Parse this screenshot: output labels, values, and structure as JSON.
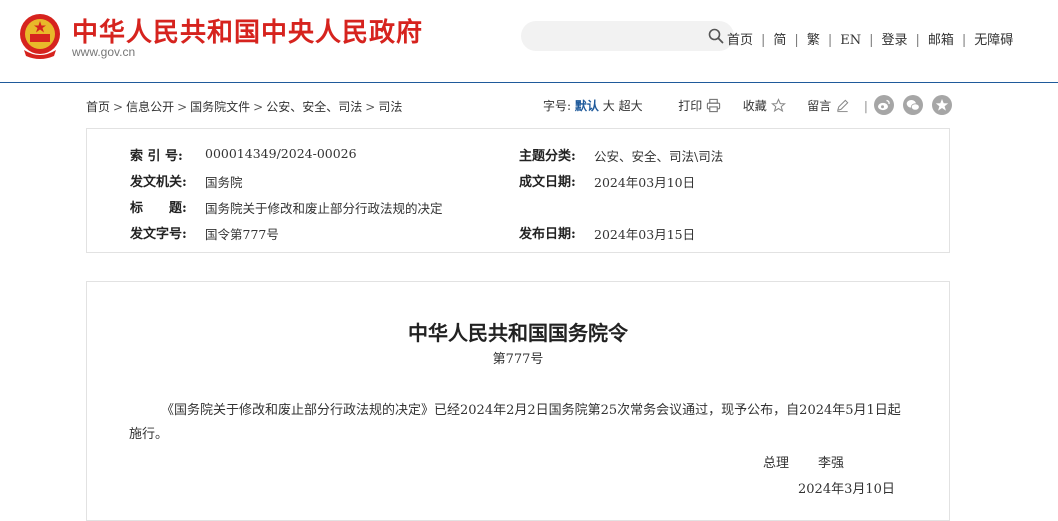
{
  "header": {
    "site_title": "中华人民共和国中央人民政府",
    "site_url": "www.gov.cn",
    "search_placeholder": "",
    "nav": [
      "首页",
      "简",
      "繁",
      "EN",
      "登录",
      "邮箱",
      "无障碍"
    ],
    "brand_color": "#d6231e",
    "line_color": "#1f5a9b"
  },
  "breadcrumb": [
    "首页",
    "信息公开",
    "国务院文件",
    "公安、安全、司法",
    "司法"
  ],
  "tools": {
    "font_label": "字号:",
    "font_default": "默认",
    "font_large": "大",
    "font_xlarge": "超大",
    "print": "打印",
    "favorite": "收藏",
    "comment": "留言",
    "share_icons": [
      "weibo-icon",
      "wechat-icon",
      "star-icon"
    ]
  },
  "meta": {
    "index_label": "索 引 号:",
    "index_value": "000014349/2024-00026",
    "category_label": "主题分类:",
    "category_value": "公安、安全、司法\\司法",
    "issuer_label": "发文机关:",
    "issuer_value": "国务院",
    "date_label": "成文日期:",
    "date_value": "2024年03月10日",
    "title_label": "标　　题:",
    "title_value": "国务院关于修改和废止部分行政法规的决定",
    "docno_label": "发文字号:",
    "docno_value": "国令第777号",
    "publish_label": "发布日期:",
    "publish_value": "2024年03月15日"
  },
  "document": {
    "title": "中华人民共和国国务院令",
    "number": "第777号",
    "body": "《国务院关于修改和废止部分行政法规的决定》已经2024年2月2日国务院第25次常务会议通过，现予公布，自2024年5月1日起施行。",
    "sign_role": "总理",
    "sign_name": "李强",
    "sign_date": "2024年3月10日"
  }
}
